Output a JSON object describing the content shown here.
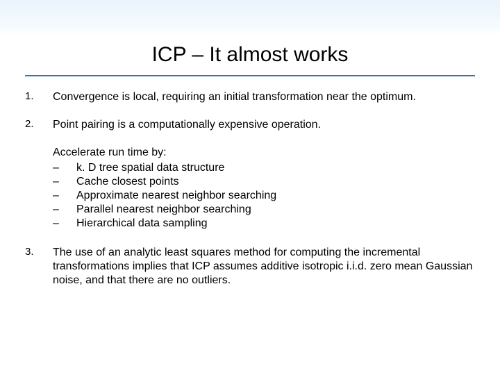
{
  "title": "ICP – It almost works",
  "points": {
    "p1_num": "1.",
    "p1_text": "Convergence is local, requiring an initial transformation near the optimum.",
    "p2_num": "2.",
    "p2_text": "Point pairing is a computationally expensive operation.",
    "p3_num": "3.",
    "p3_text": "The use of an analytic least squares method for computing the incremental transformations implies that ICP  assumes additive isotropic i.i.d. zero mean Gaussian noise, and that there are no outliers."
  },
  "accel": {
    "lead": "Accelerate run time by:",
    "dash": "–",
    "i1": "k. D tree spatial data structure",
    "i2": "Cache closest points",
    "i3": "Approximate nearest neighbor searching",
    "i4": "Parallel nearest neighbor searching",
    "i5": "Hierarchical data sampling"
  }
}
